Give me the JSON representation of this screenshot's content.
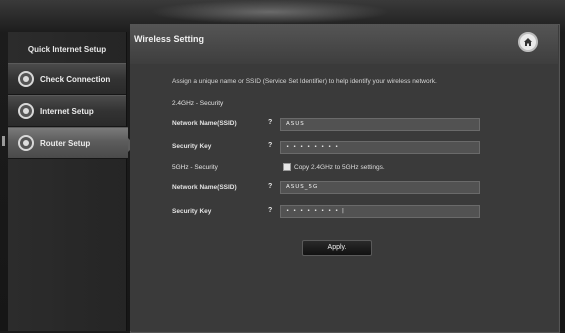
{
  "sidebar": {
    "title": "Quick Internet Setup",
    "items": [
      {
        "label": "Check Connection"
      },
      {
        "label": "Internet Setup"
      },
      {
        "label": "Router Setup"
      }
    ]
  },
  "panel": {
    "title": "Wireless Setting",
    "description": "Assign a unique name or SSID (Service Set Identifier) to help identify your wireless network.",
    "band_24": {
      "section_label": "2.4GHz - Security",
      "ssid_label": "Network Name(SSID)",
      "ssid_value": "ASUS",
      "key_label": "Security Key",
      "key_value": "• • • • • • • •",
      "help": "?"
    },
    "band_5": {
      "section_label": "5GHz - Security",
      "copy_label": "Copy 2.4GHz to 5GHz settings.",
      "ssid_label": "Network Name(SSID)",
      "ssid_value": "ASUS_5G",
      "key_label": "Security Key",
      "key_value": "• • • • • • • • |",
      "help": "?"
    },
    "apply_label": "Apply."
  }
}
